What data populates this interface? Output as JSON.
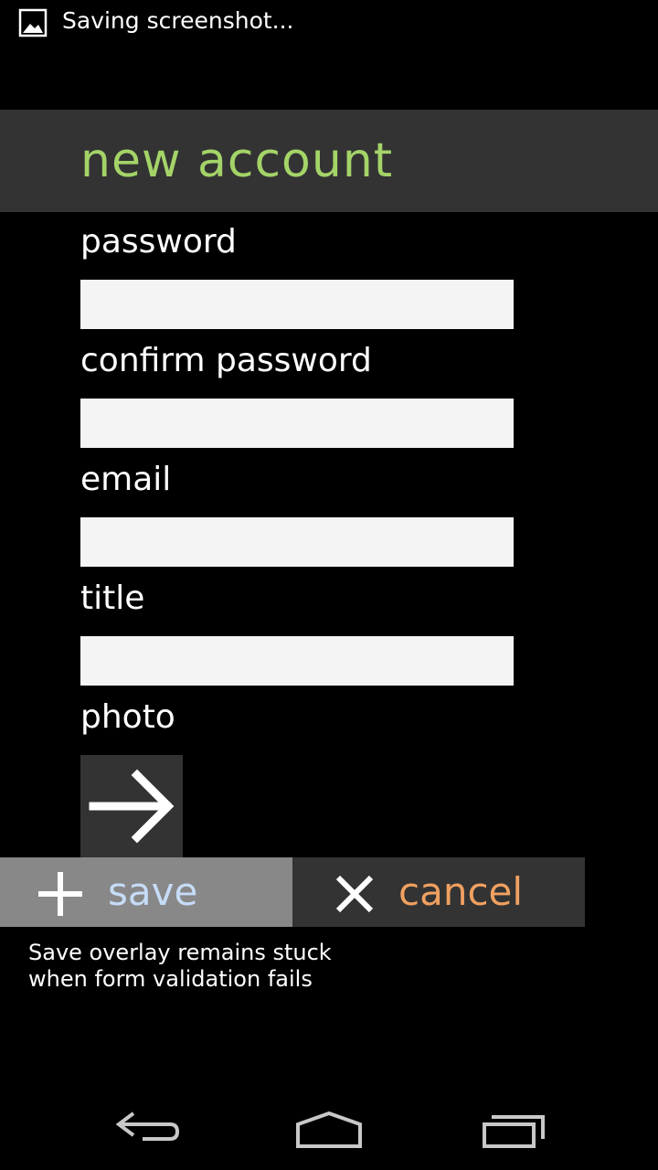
{
  "status_bar": {
    "notification_icon": "image-icon",
    "notification_text": "Saving screenshot..."
  },
  "header": {
    "title": "new account"
  },
  "form": {
    "password_label": "password",
    "confirm_password_label": "confirm password",
    "email_label": "email",
    "title_label": "title",
    "photo_label": "photo",
    "password_value": "",
    "confirm_password_value": "",
    "email_value": "",
    "title_value": "",
    "photo_button_icon": "arrow-right-icon"
  },
  "actions": {
    "save_label": "save",
    "save_icon": "plus-icon",
    "cancel_label": "cancel",
    "cancel_icon": "close-icon"
  },
  "note": {
    "line1": "Save overlay remains stuck",
    "line2": "when form validation fails"
  },
  "nav_bar": {
    "back_icon": "back-icon",
    "home_icon": "home-icon",
    "recents_icon": "recent-apps-icon"
  },
  "colors": {
    "title": "#a4d468",
    "save_text": "#c6dcf7",
    "cancel_text": "#f0a060",
    "header_bg": "#333333",
    "save_bg": "#888888",
    "field_bg": "#f4f4f4"
  }
}
